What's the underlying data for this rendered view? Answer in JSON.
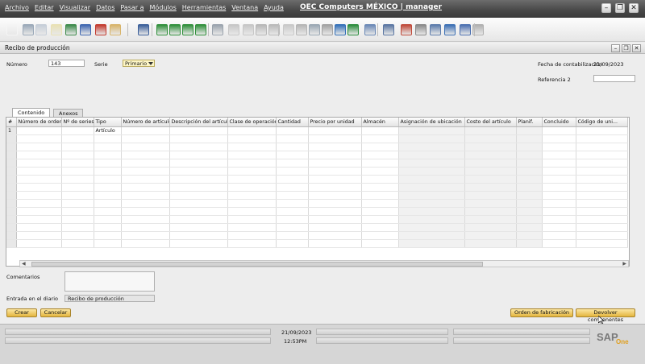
{
  "menubar": {
    "items": [
      "Archivo",
      "Editar",
      "Visualizar",
      "Datos",
      "Pasar a",
      "Módulos",
      "Herramientas",
      "Ventana",
      "Ayuda"
    ],
    "title": "OEC Computers MÉXICO | manager"
  },
  "document": {
    "title": "Recibo de producción"
  },
  "header": {
    "numero_label": "Número",
    "numero_value": "143",
    "serie_label": "Serie",
    "serie_value": "Primario",
    "fecha_label": "Fecha de contabilización",
    "fecha_value": "21/09/2023",
    "referencia_label": "Referencia 2",
    "referencia_value": ""
  },
  "tabs": [
    "Contenido",
    "Anexos"
  ],
  "grid": {
    "columns": [
      "#",
      "Número de orden",
      "Nº de series",
      "Tipo",
      "Número de artículo",
      "Descripción del artículo",
      "Clase de operación",
      "Cantidad",
      "Precio por unidad",
      "Almacén",
      "Asignación de ubicación",
      "Costo del artículo",
      "Planif.",
      "Concluido",
      "Código de uni..."
    ],
    "rows": [
      [
        "1",
        "",
        "",
        "Artículo",
        "",
        "",
        "",
        "",
        "",
        "",
        "",
        "",
        "",
        "",
        ""
      ]
    ]
  },
  "footer": {
    "comentarios_label": "Comentarios",
    "comentarios_value": "",
    "diario_label": "Entrada en el diario",
    "diario_value": "Recibo de producción"
  },
  "buttons": {
    "crear": "Crear",
    "cancelar": "Cancelar",
    "orden": "Orden de fabricación",
    "devolver": "Devolver componentes"
  },
  "status": {
    "date": "21/09/2023",
    "time": "12:53PM",
    "logo_text": "SAP",
    "logo_sub": "One"
  },
  "colors": {
    "button_accent": "#e4b53d",
    "select_bg": "#fdf6c6",
    "menubar_bg": "#4a4a4a"
  }
}
